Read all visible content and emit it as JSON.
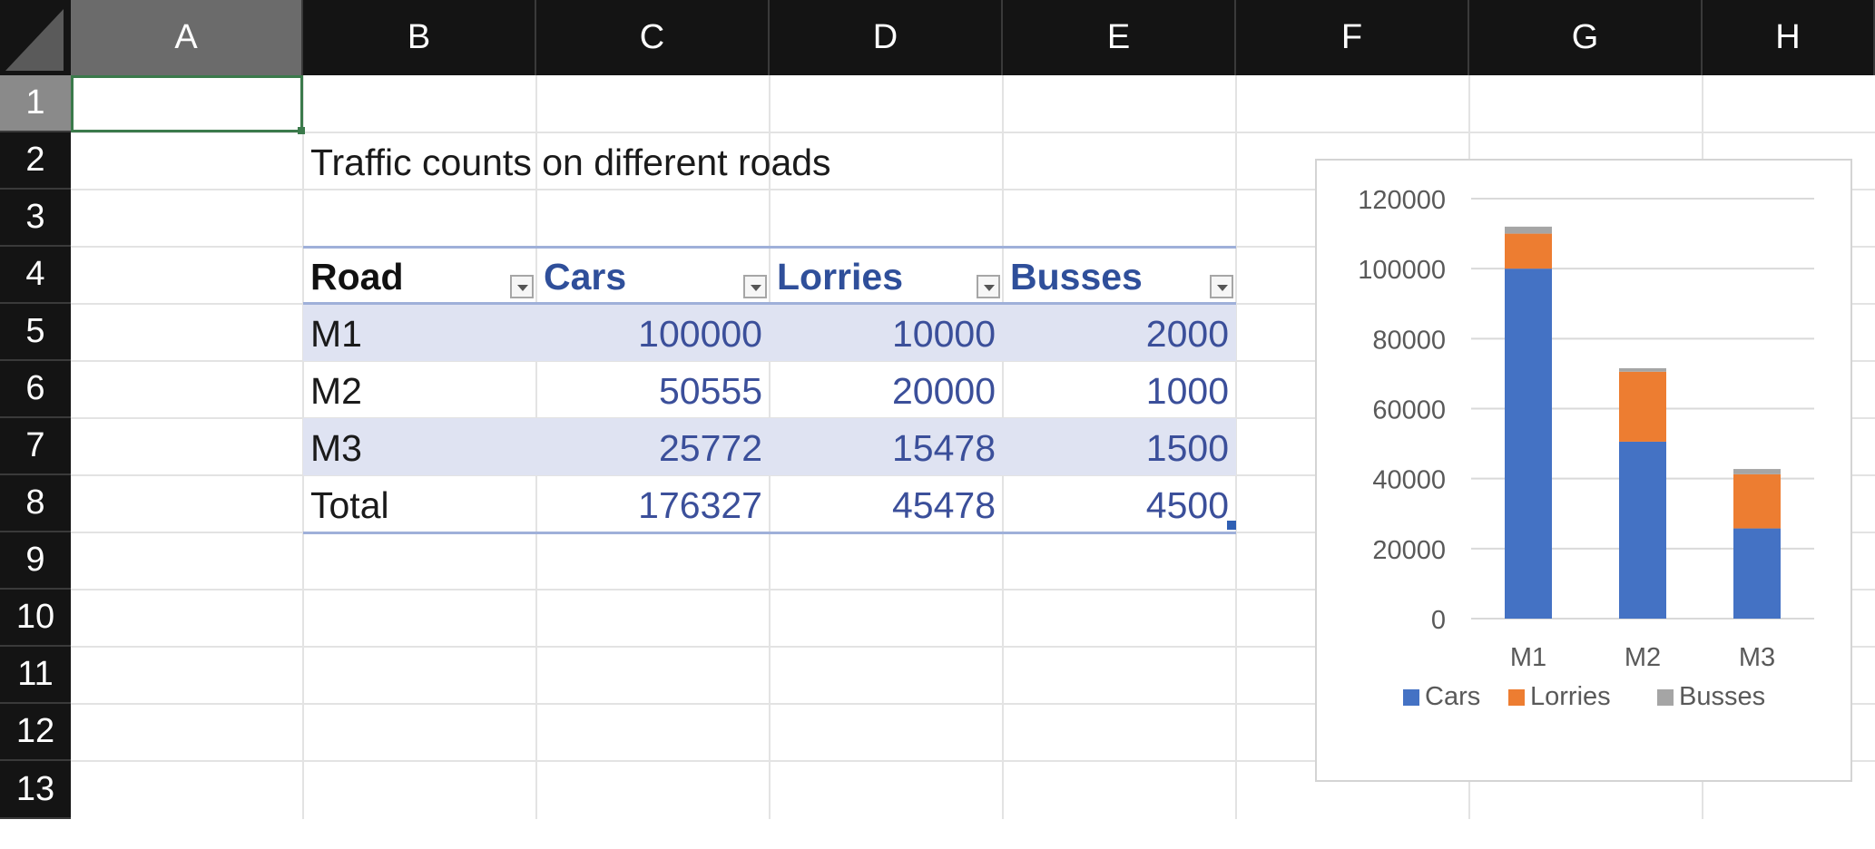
{
  "columns": [
    "A",
    "B",
    "C",
    "D",
    "E",
    "F",
    "G",
    "H"
  ],
  "rows": [
    "1",
    "2",
    "3",
    "4",
    "5",
    "6",
    "7",
    "8",
    "9",
    "10",
    "11",
    "12",
    "13"
  ],
  "sheet_title": "Traffic counts on different roads",
  "table": {
    "headers": [
      "Road",
      "Cars",
      "Lorries",
      "Busses"
    ],
    "rows": [
      {
        "road": "M1",
        "cars": "100000",
        "lorries": "10000",
        "busses": "2000"
      },
      {
        "road": "M2",
        "cars": "50555",
        "lorries": "20000",
        "busses": "1000"
      },
      {
        "road": "M3",
        "cars": "25772",
        "lorries": "15478",
        "busses": "1500"
      }
    ],
    "total": {
      "road": "Total",
      "cars": "176327",
      "lorries": "45478",
      "busses": "4500"
    }
  },
  "colors": {
    "header_bg": "#141414",
    "table_band": "#dfe3f2",
    "number_text": "#3b4f9a",
    "cars": "#4472c4",
    "lorries": "#ed7d31",
    "busses": "#a5a5a5"
  },
  "chart_data": {
    "type": "bar",
    "stacked": true,
    "categories": [
      "M1",
      "M2",
      "M3"
    ],
    "series": [
      {
        "name": "Cars",
        "values": [
          100000,
          50555,
          25772
        ],
        "color": "#4472c4"
      },
      {
        "name": "Lorries",
        "values": [
          10000,
          20000,
          15478
        ],
        "color": "#ed7d31"
      },
      {
        "name": "Busses",
        "values": [
          2000,
          1000,
          1500
        ],
        "color": "#a5a5a5"
      }
    ],
    "ylim": [
      0,
      120000
    ],
    "yticks": [
      "0",
      "20000",
      "40000",
      "60000",
      "80000",
      "100000",
      "120000"
    ],
    "grid": true,
    "legend": "bottom"
  }
}
